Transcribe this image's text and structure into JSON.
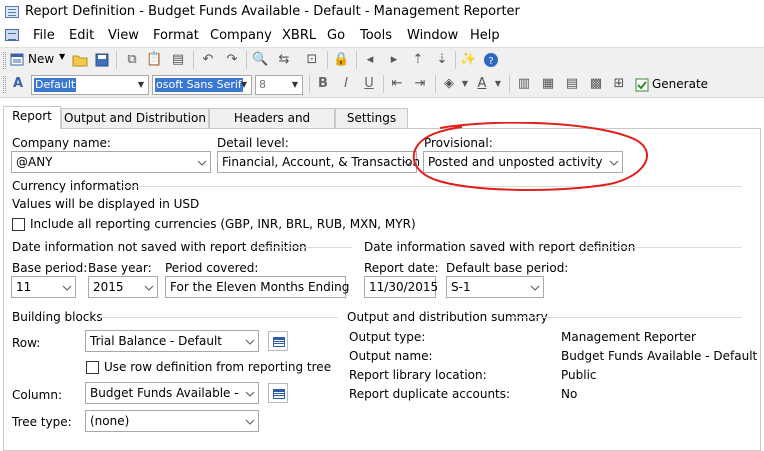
{
  "window": {
    "title": "Report Definition - Budget Funds Available - Default - Management Reporter"
  },
  "menu": [
    "File",
    "Edit",
    "View",
    "Format",
    "Company",
    "XBRL",
    "Go",
    "Tools",
    "Window",
    "Help"
  ],
  "toolbar": {
    "new_label": "New",
    "generate_label": "Generate",
    "style_value": "Default",
    "font_value": "osoft Sans Serif",
    "size_value": "8",
    "bold": "B",
    "italic": "I",
    "underline": "U",
    "icons": [
      "new-icon",
      "open-icon",
      "save-icon",
      "copy-icon",
      "paste-icon",
      "undo-icon",
      "redo-icon",
      "find-icon",
      "lock-icon",
      "back-icon",
      "forward-icon",
      "wizard-icon",
      "help-icon",
      "insert-icon",
      "outdent-icon",
      "indent-icon",
      "fill-color-icon",
      "font-color-icon",
      "align-icon",
      "generate-icon"
    ]
  },
  "tabs": [
    "Report",
    "Output and Distribution",
    "Headers and Footers",
    "Settings"
  ],
  "form": {
    "company_label": "Company name:",
    "company_value": "@ANY",
    "detail_label": "Detail level:",
    "detail_value": "Financial, Account, & Transaction",
    "provisional_label": "Provisional:",
    "provisional_value": "Posted and unposted activity",
    "currency_header": "Currency information",
    "currency_note": "Values will be displayed in USD",
    "include_currencies_label": "Include all reporting currencies (GBP, INR, BRL, RUB, MXN, MYR)",
    "include_currencies_checked": false,
    "date_not_saved_header": "Date information not saved with report definition",
    "date_saved_header": "Date information saved with report definition",
    "base_period_label": "Base period:",
    "base_period_value": "11",
    "base_year_label": "Base year:",
    "base_year_value": "2015",
    "period_covered_label": "Period covered:",
    "period_covered_value": "For the Eleven Months Ending",
    "report_date_label": "Report date:",
    "report_date_value": "11/30/2015",
    "default_base_period_label": "Default base period:",
    "default_base_period_value": "S-1",
    "building_blocks_header": "Building blocks",
    "row_label": "Row:",
    "row_value": "Trial Balance - Default",
    "use_row_def_label": "Use row definition from reporting tree",
    "use_row_def_checked": false,
    "column_label": "Column:",
    "column_value": "Budget Funds Available - Defau",
    "tree_type_label": "Tree type:",
    "tree_type_value": "(none)",
    "summary_header": "Output and distribution summary",
    "summary": [
      {
        "key": "Output type:",
        "value": "Management Reporter"
      },
      {
        "key": "Output name:",
        "value": "Budget Funds Available - Default"
      },
      {
        "key": "Report library location:",
        "value": "Public"
      },
      {
        "key": "Report duplicate accounts:",
        "value": "No"
      }
    ]
  },
  "annotation": {
    "color": "#e0201b",
    "shape": "hand-drawn ellipse around Provisional field"
  }
}
